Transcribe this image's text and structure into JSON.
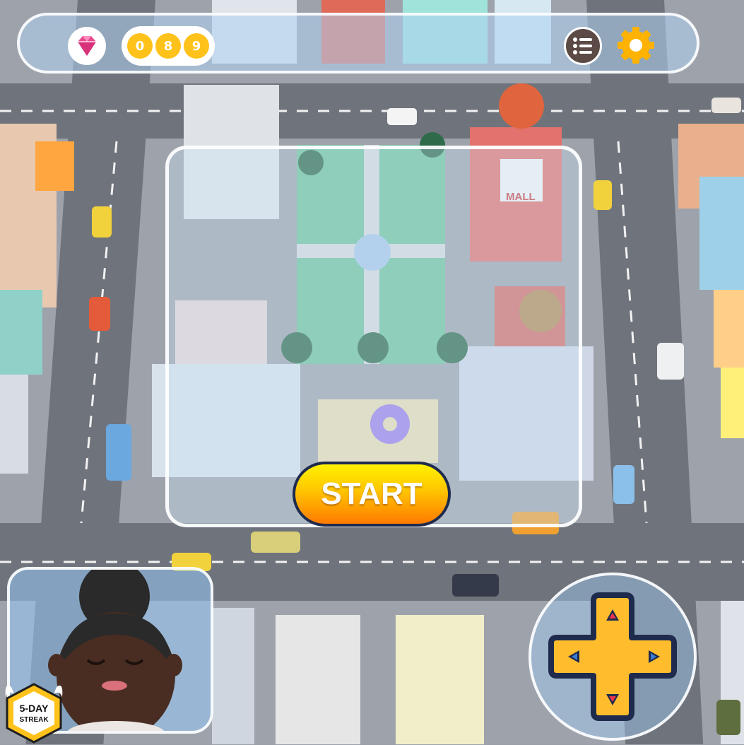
{
  "hud": {
    "gem_icon": "diamond-gem-icon",
    "counter_digits": [
      "0",
      "8",
      "9"
    ],
    "menu_icon": "list-menu-icon",
    "settings_icon": "gear-icon"
  },
  "map": {
    "mall_sign": "MALL"
  },
  "start_button": {
    "label": "START"
  },
  "streak_badge": {
    "line1": "5-DAY",
    "line2": "STREAK"
  },
  "dpad": {
    "icon": "dpad-icon"
  },
  "colors": {
    "accent_yellow": "#ffc21a",
    "start_orange": "#ff7a00",
    "dpad_yellow": "#ffbd2e",
    "dpad_outline": "#1f2b4d"
  }
}
